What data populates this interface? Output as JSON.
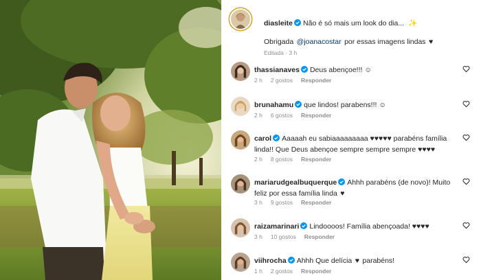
{
  "post": {
    "username": "diasleite",
    "caption": "Não é só mais um look do dia...  ✨",
    "thanks_prefix": "Obrigada",
    "thanks_mention": "@joanacostar",
    "thanks_suffix": "por essas imagens lindas",
    "meta": "Editada · 3 h"
  },
  "comments": [
    {
      "username": "thassianaves",
      "text": "Deus abençoe!!! ☺",
      "time": "2 h",
      "likes": "2 gostos",
      "reply": "Responder"
    },
    {
      "username": "brunahamu",
      "text": "que lindos! parabens!!! ☺",
      "time": "2 h",
      "likes": "6 gostos",
      "reply": "Responder"
    },
    {
      "username": "carol",
      "text": "Aaaaah eu sabiaaaaaaaaa ♥♥♥♥♥ parabéns família linda!! Que Deus abençoe sempre sempre sempre ♥♥♥♥",
      "time": "2 h",
      "likes": "8 gostos",
      "reply": "Responder"
    },
    {
      "username": "mariarudgealbuquerque",
      "text": "Ahhh parabéns (de novo)! Muito feliz por essa família linda",
      "time": "3 h",
      "likes": "9 gostos",
      "reply": "Responder"
    },
    {
      "username": "raizamarinari",
      "text": "Lindoooos! Família abençoada! ♥♥♥♥",
      "time": "3 h",
      "likes": "10 gostos",
      "reply": "Responder"
    },
    {
      "username": "viihrocha",
      "text": "Ahhh Que delícia",
      "text2": "parabéns!",
      "time": "1 h",
      "likes": "2 gostos",
      "reply": "Responder"
    }
  ],
  "icons": {
    "verified": "verified-badge-icon",
    "like": "heart-outline-icon"
  },
  "colors": {
    "verified": "#0095f6",
    "link": "#00376b",
    "meta": "#8e8e8e"
  }
}
